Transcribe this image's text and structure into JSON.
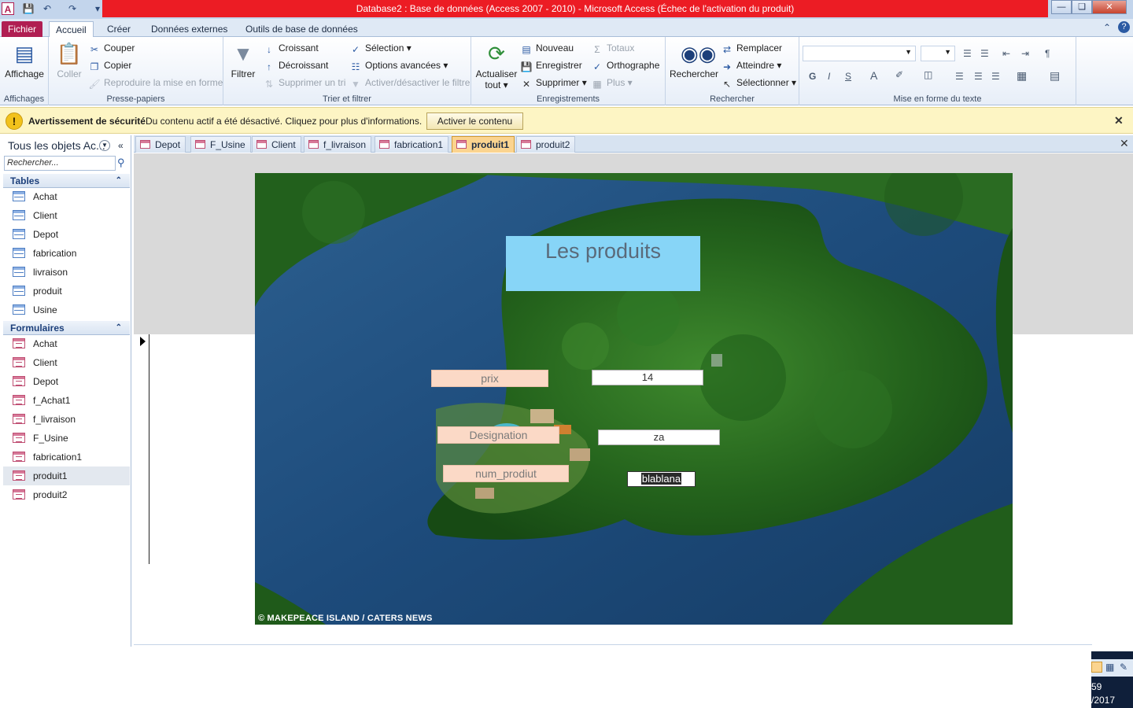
{
  "window": {
    "title": "Database2 : Base de données (Access 2007 - 2010)  -  Microsoft Access (Échec de l'activation du produit)",
    "app_icon_letter": "A",
    "colors": {
      "title_bar": "#ec1c24",
      "fichier_tab": "#b01e52",
      "active_doc_tab": "#fbd48f"
    }
  },
  "menu_tabs": [
    "Fichier",
    "Accueil",
    "Créer",
    "Données externes",
    "Outils de base de données"
  ],
  "ribbon": {
    "affichages": {
      "view_label": "Affichage",
      "group": "Affichages"
    },
    "presse_papiers": {
      "paste": "Coller",
      "cut": "Couper",
      "copy": "Copier",
      "format_painter": "Reproduire la mise en forme",
      "group": "Presse-papiers"
    },
    "trier_filtrer": {
      "filter": "Filtrer",
      "asc": "Croissant",
      "desc": "Décroissant",
      "remove_sort": "Supprimer un tri",
      "selection": "Sélection",
      "advanced": "Options avancées",
      "toggle_filter": "Activer/désactiver le filtre",
      "group": "Trier et filtrer"
    },
    "enregistrements": {
      "refresh": "Actualiser",
      "refresh2": "tout",
      "new": "Nouveau",
      "save": "Enregistrer",
      "delete": "Supprimer",
      "totals": "Totaux",
      "spelling": "Orthographe",
      "more": "Plus",
      "group": "Enregistrements"
    },
    "rechercher": {
      "find": "Rechercher",
      "replace": "Remplacer",
      "goto": "Atteindre",
      "select": "Sélectionner",
      "group": "Rechercher"
    },
    "mise_en_forme": {
      "bold": "G",
      "italic": "I",
      "underline": "S",
      "group": "Mise en forme du texte"
    }
  },
  "security_bar": {
    "title": "Avertissement de sécurité",
    "message": "Du contenu actif a été désactivé. Cliquez pour plus d'informations.",
    "button": "Activer le contenu"
  },
  "nav_pane": {
    "header": "Tous les objets Ac...",
    "search_placeholder": "Rechercher...",
    "tables_label": "Tables",
    "tables": [
      "Achat",
      "Client",
      "Depot",
      "fabrication",
      "livraison",
      "produit",
      "Usine"
    ],
    "forms_label": "Formulaires",
    "forms": [
      "Achat",
      "Client",
      "Depot",
      "f_Achat1",
      "f_livraison",
      "F_Usine",
      "fabrication1",
      "produit1",
      "produit2"
    ],
    "selected_form": "produit1"
  },
  "doc_tabs": [
    "Depot",
    "F_Usine",
    "Client",
    "f_livraison",
    "fabrication1",
    "produit1",
    "produit2"
  ],
  "active_doc_tab": "produit1",
  "form": {
    "title": "Les produits",
    "image_credit": "© MAKEPEACE ISLAND / CATERS NEWS",
    "fields": [
      {
        "label": "prix",
        "value": "14"
      },
      {
        "label": "Designation",
        "value": "za"
      },
      {
        "label": "num_prodiut",
        "value": "blablana"
      }
    ]
  },
  "taskbar": {
    "time_fragment": "59",
    "date_fragment": "/2017"
  }
}
